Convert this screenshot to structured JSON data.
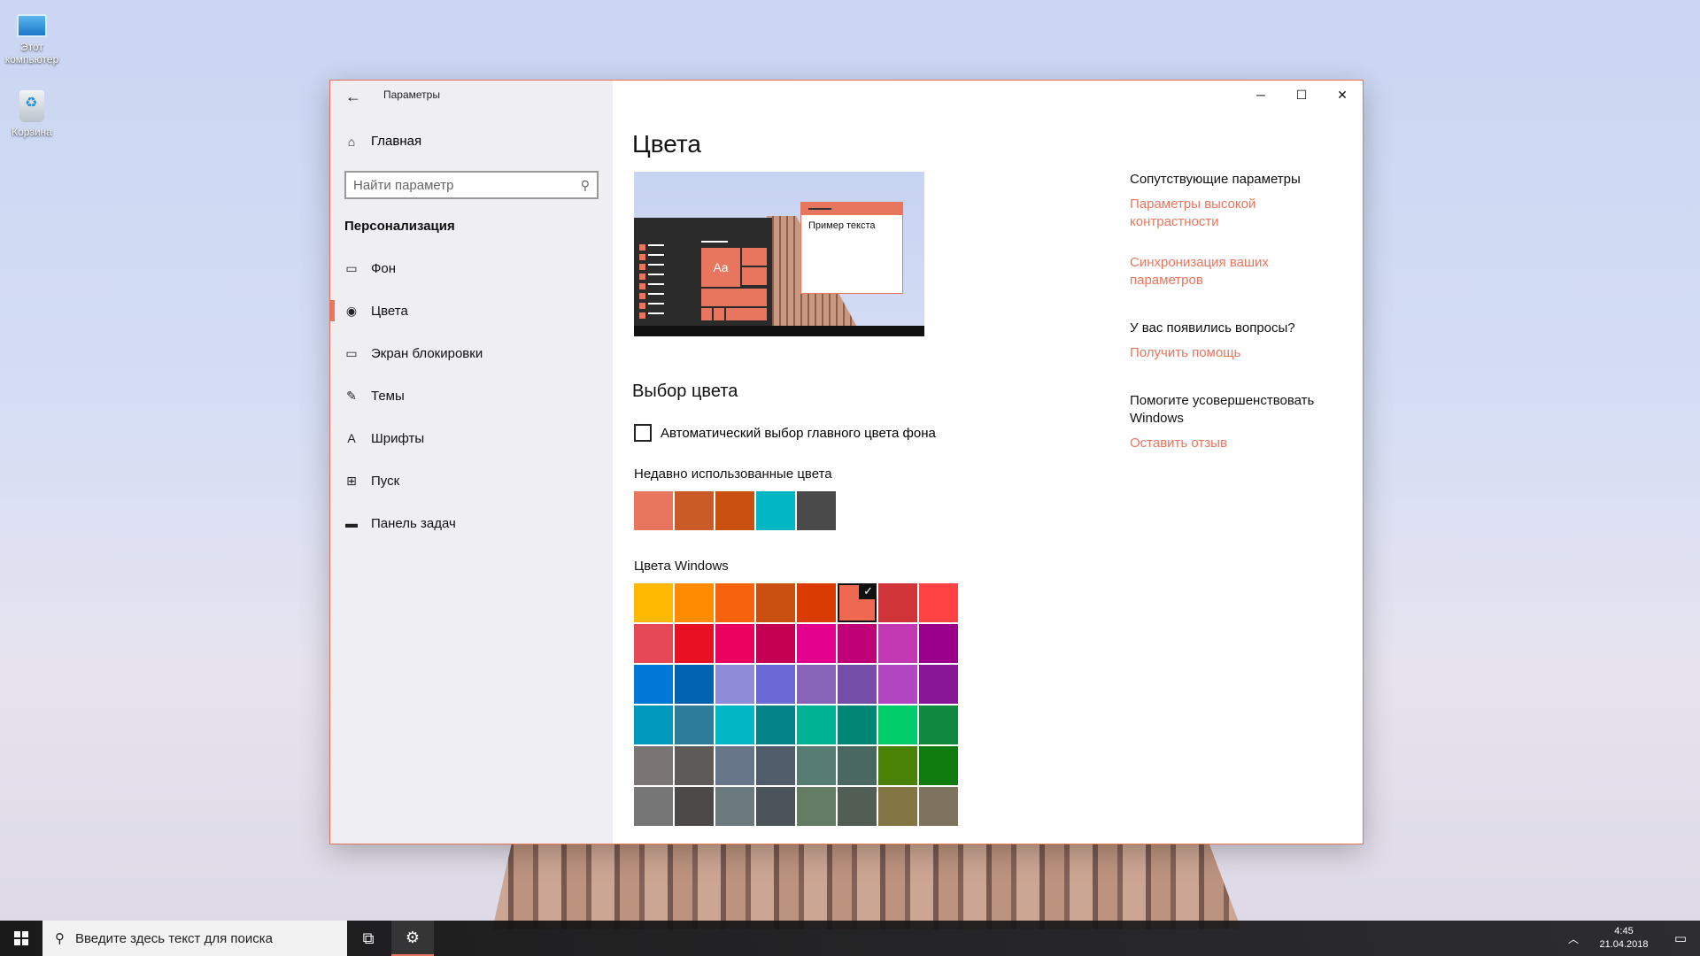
{
  "desktop": {
    "icons": [
      {
        "label": "Этот компьютер",
        "icon": "computer-icon"
      },
      {
        "label": "Корзина",
        "icon": "recycle-bin-icon"
      }
    ]
  },
  "window": {
    "title": "Параметры",
    "controls": {
      "minimize": "─",
      "maximize": "☐",
      "close": "✕"
    }
  },
  "sidebar": {
    "home_label": "Главная",
    "search_placeholder": "Найти параметр",
    "section_title": "Персонализация",
    "items": [
      {
        "label": "Фон",
        "icon": "picture-icon",
        "active": false
      },
      {
        "label": "Цвета",
        "icon": "palette-icon",
        "active": true
      },
      {
        "label": "Экран блокировки",
        "icon": "lock-screen-icon",
        "active": false
      },
      {
        "label": "Темы",
        "icon": "themes-icon",
        "active": false
      },
      {
        "label": "Шрифты",
        "icon": "fonts-icon",
        "active": false
      },
      {
        "label": "Пуск",
        "icon": "start-icon",
        "active": false
      },
      {
        "label": "Панель задач",
        "icon": "taskbar-icon",
        "active": false
      }
    ]
  },
  "main": {
    "title": "Цвета",
    "preview": {
      "tile_text": "Aa",
      "sample_text": "Пример текста"
    },
    "choose_color_title": "Выбор цвета",
    "auto_checkbox_label": "Автоматический выбор главного цвета фона",
    "auto_checked": false,
    "recent_label": "Недавно использованные цвета",
    "recent_colors": [
      "#e8765e",
      "#ca5b27",
      "#c9500f",
      "#00b7c3",
      "#4a4a4a"
    ],
    "windows_colors_label": "Цвета Windows",
    "windows_colors": [
      [
        "#ffb900",
        "#ff8c00",
        "#f7630c",
        "#ca5010",
        "#da3b01",
        "#ef6950",
        "#d13438",
        "#ff4343"
      ],
      [
        "#e74856",
        "#e81123",
        "#ea005e",
        "#c30052",
        "#e3008c",
        "#bf0077",
        "#c239b3",
        "#9a0089"
      ],
      [
        "#0078d7",
        "#0063b1",
        "#8e8cd8",
        "#6b69d6",
        "#8764b8",
        "#744da9",
        "#b146c2",
        "#881798"
      ],
      [
        "#0099bc",
        "#2d7d9a",
        "#00b7c3",
        "#038387",
        "#00b294",
        "#018574",
        "#00cc6a",
        "#10893e"
      ],
      [
        "#7a7574",
        "#5d5a58",
        "#68768a",
        "#515c6b",
        "#567c73",
        "#486860",
        "#498205",
        "#107c10"
      ],
      [
        "#767676",
        "#4c4a48",
        "#69797e",
        "#4a5459",
        "#647c64",
        "#525e54",
        "#847545",
        "#7e735f"
      ]
    ],
    "selected_color": "#ef6950",
    "accent": "#e8765e"
  },
  "related": {
    "heading": "Сопутствующие параметры",
    "links": [
      "Параметры высокой контрастности",
      "Синхронизация ваших параметров"
    ],
    "questions_heading": "У вас появились вопросы?",
    "help_link": "Получить помощь",
    "improve_heading": "Помогите усовершенствовать Windows",
    "feedback_link": "Оставить отзыв"
  },
  "taskbar": {
    "search_placeholder": "Введите здесь текст для поиска",
    "time": "4:45",
    "date": "21.04.2018"
  }
}
